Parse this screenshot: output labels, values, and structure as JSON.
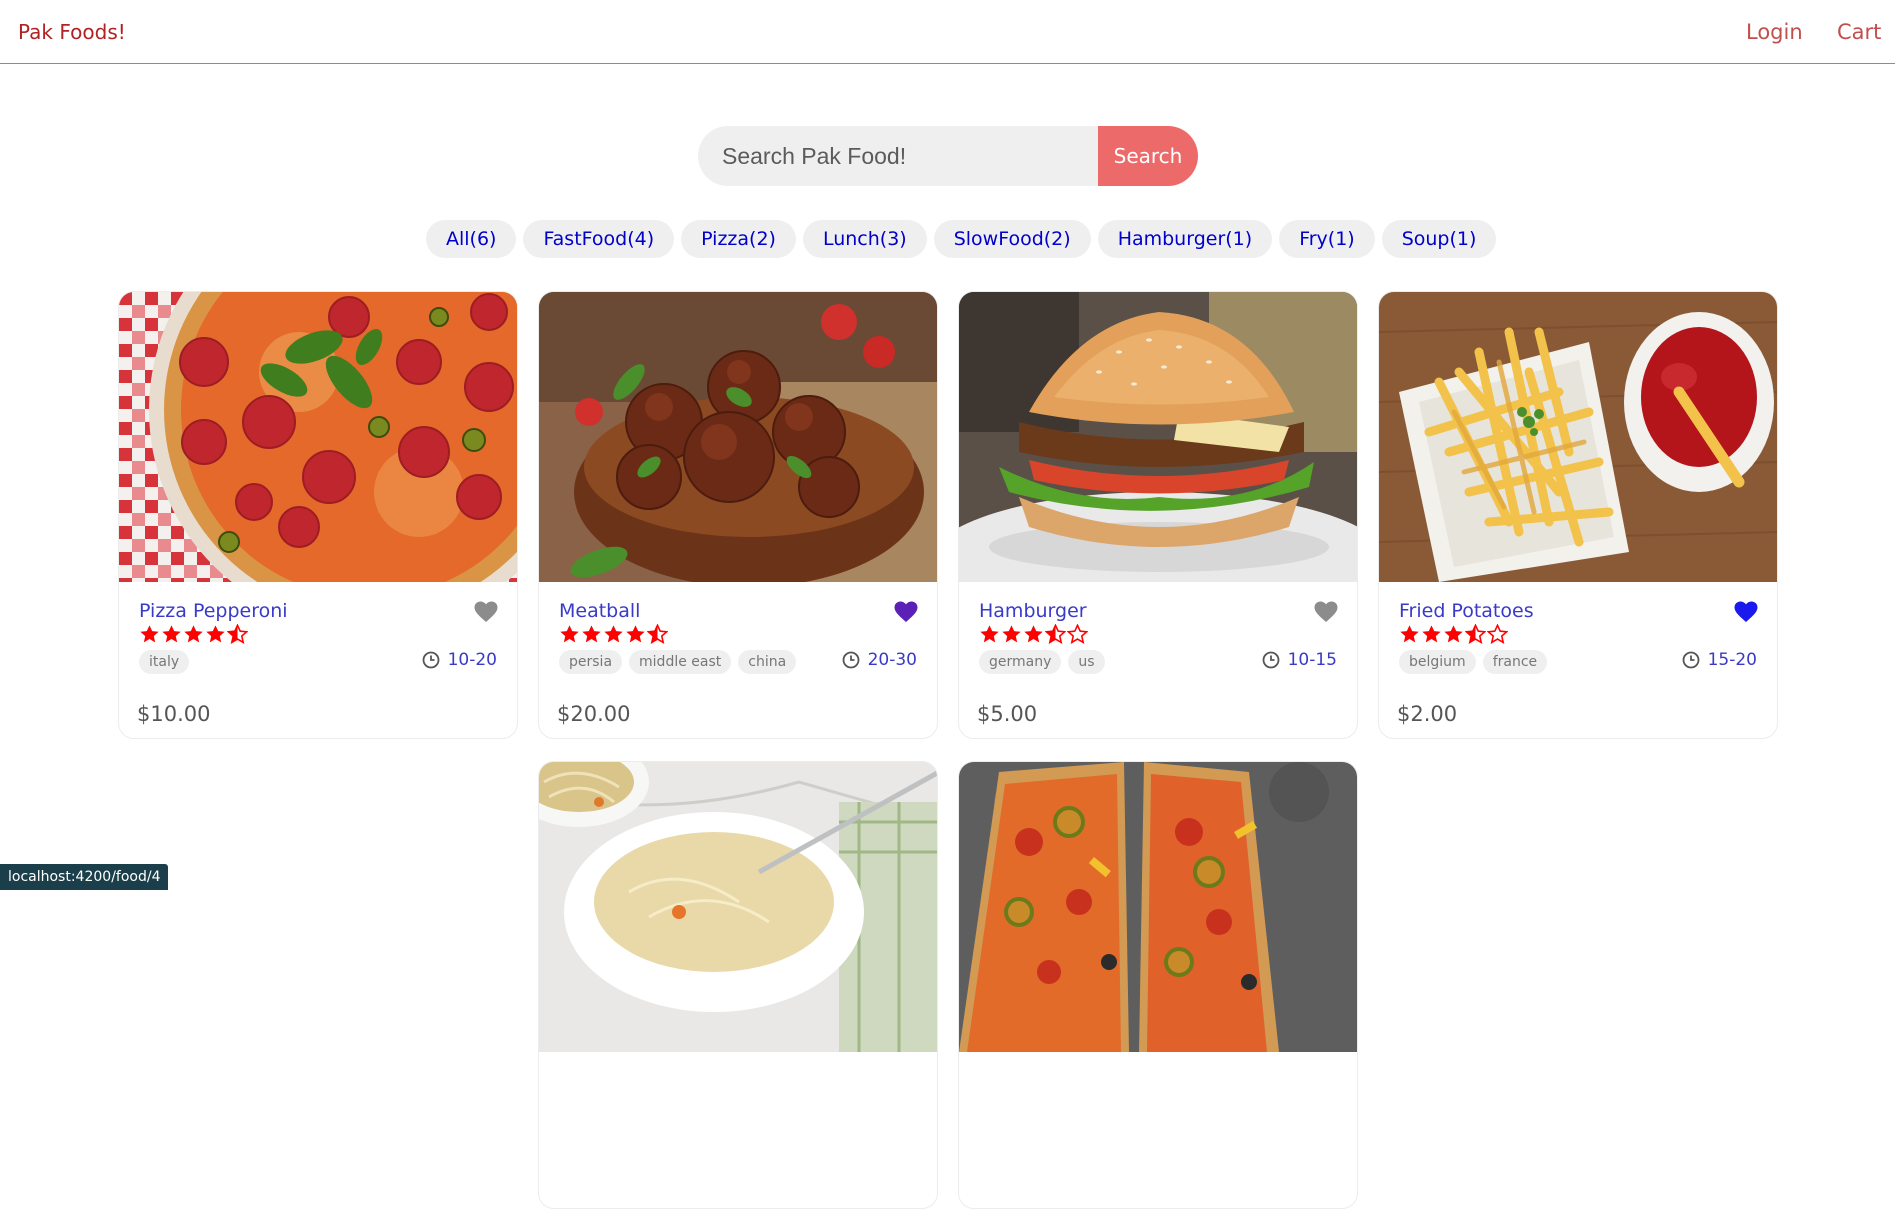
{
  "header": {
    "brand": "Pak Foods!",
    "login": "Login",
    "cart": "Cart"
  },
  "search": {
    "placeholder": "Search Pak Food!",
    "button": "Search"
  },
  "tags": [
    "All(6)",
    "FastFood(4)",
    "Pizza(2)",
    "Lunch(3)",
    "SlowFood(2)",
    "Hamburger(1)",
    "Fry(1)",
    "Soup(1)"
  ],
  "foods": [
    {
      "name": "Pizza Pepperoni",
      "stars": 4.5,
      "origins": [
        "italy"
      ],
      "cook_time": "10-20",
      "price": "$10.00",
      "favorite_color": "#8c8c8c"
    },
    {
      "name": "Meatball",
      "stars": 4.5,
      "origins": [
        "persia",
        "middle east",
        "china"
      ],
      "cook_time": "20-30",
      "price": "$20.00",
      "favorite_color": "#5b21b6"
    },
    {
      "name": "Hamburger",
      "stars": 3.5,
      "origins": [
        "germany",
        "us"
      ],
      "cook_time": "10-15",
      "price": "$5.00",
      "favorite_color": "#8c8c8c"
    },
    {
      "name": "Fried Potatoes",
      "stars": 3.5,
      "origins": [
        "belgium",
        "france"
      ],
      "cook_time": "15-20",
      "price": "$2.00",
      "favorite_color": "#1a1aee"
    },
    {
      "name": "",
      "stars": 0,
      "origins": [],
      "cook_time": "",
      "price": ""
    },
    {
      "name": "",
      "stars": 0,
      "origins": [],
      "cook_time": "",
      "price": ""
    }
  ],
  "statusbar": {
    "url": "localhost:4200/food/4"
  }
}
